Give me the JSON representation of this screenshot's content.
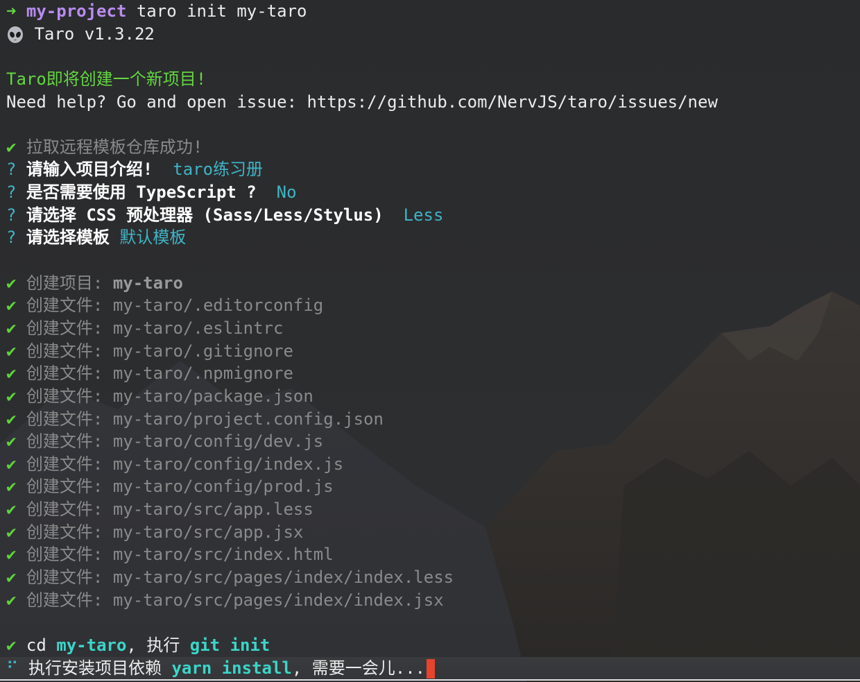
{
  "prompt": {
    "arrow": "➜",
    "dir": "my-project",
    "command": " taro init my-taro"
  },
  "version": {
    "icon": "alien-icon",
    "text": "Taro v1.3.22"
  },
  "intro": {
    "title": "Taro即将创建一个新项目!",
    "help": "Need help? Go and open issue: https://github.com/NervJS/taro/issues/new"
  },
  "check_mark": "✔",
  "question_mark": "?",
  "fetch_success": "拉取远程模板仓库成功!",
  "questions": [
    {
      "label": "请输入项目介绍! ",
      "answer": "taro练习册"
    },
    {
      "label": "是否需要使用 TypeScript ? ",
      "answer": "No"
    },
    {
      "label": "请选择 CSS 预处理器 (Sass/Less/Stylus) ",
      "answer": "Less"
    },
    {
      "label": "请选择模板",
      "answer": "默认模板"
    }
  ],
  "create_project": {
    "label": "创建项目: ",
    "name": "my-taro"
  },
  "create_file_label": "创建文件: ",
  "files": [
    "my-taro/.editorconfig",
    "my-taro/.eslintrc",
    "my-taro/.gitignore",
    "my-taro/.npmignore",
    "my-taro/package.json",
    "my-taro/project.config.json",
    "my-taro/config/dev.js",
    "my-taro/config/index.js",
    "my-taro/config/prod.js",
    "my-taro/src/app.less",
    "my-taro/src/app.jsx",
    "my-taro/src/index.html",
    "my-taro/src/pages/index/index.less",
    "my-taro/src/pages/index/index.jsx"
  ],
  "git_line": {
    "cd": "cd ",
    "dir": "my-taro",
    "sep": ", 执行 ",
    "cmd": "git init"
  },
  "install_line": {
    "spinner": "⠋",
    "prefix": "执行安装项目依赖 ",
    "cmd": "yarn install",
    "suffix": ", 需要一会儿..."
  },
  "colors": {
    "prompt_arrow": "#63d73f",
    "directory": "#b98cf0",
    "answer": "#3fb4c6",
    "command": "#3ad6c8",
    "cursor": "#e8432f"
  }
}
